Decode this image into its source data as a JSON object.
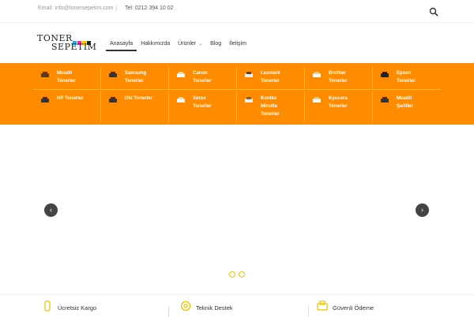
{
  "topbar": {
    "email": "Email: info@tonersepetim.com",
    "separator": "|",
    "tel": "Tel: 0212 394 10 02"
  },
  "logo": {
    "line1": "TONER",
    "line2": "SEPETIM"
  },
  "nav": {
    "items": [
      {
        "label": "Anasayfa"
      },
      {
        "label": "Hakkımızda"
      },
      {
        "label": "Ürünler"
      },
      {
        "label": "Blog"
      },
      {
        "label": "İletişim"
      }
    ]
  },
  "categories": {
    "row1": [
      {
        "label": "Muadil\nTonerler"
      },
      {
        "label": "Samsung\nTonerler"
      },
      {
        "label": "Canon\nTonerler"
      },
      {
        "label": "Lexmark\nTonerler"
      },
      {
        "label": "Brother\nTonerler"
      },
      {
        "label": "Epson\nTonerler"
      }
    ],
    "row2": [
      {
        "label": "HP Tonerler"
      },
      {
        "label": "Oki Tonerler"
      },
      {
        "label": "Xerox\nTonerler"
      },
      {
        "label": "Konika\nMinolta\nTonerler"
      },
      {
        "label": "Kyocera\nTonerler"
      },
      {
        "label": "Muadil\nŞeritler"
      }
    ]
  },
  "slider": {
    "prev": "‹",
    "next": "›"
  },
  "features": [
    {
      "label": "Ücretsiz Kargo"
    },
    {
      "label": "Teknik Destek"
    },
    {
      "label": "Güvenli Ödeme"
    }
  ],
  "colors": {
    "accent": "#ff8c00",
    "dot_border": "#f2c200"
  }
}
